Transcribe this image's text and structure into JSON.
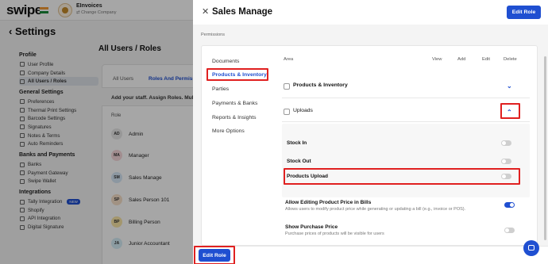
{
  "app": {
    "logo": "swipe",
    "company_name": "EInvoices",
    "change_company": "⇄ Change Company",
    "settings_title": "‹ Settings"
  },
  "sidebar": {
    "groups": [
      {
        "title": "Profile",
        "items": [
          "User Profile",
          "Company Details",
          "All Users / Roles"
        ]
      },
      {
        "title": "General Settings",
        "items": [
          "Preferences",
          "Thermal Print Settings",
          "Barcode Settings",
          "Signatures",
          "Notes & Terms",
          "Auto Reminders"
        ]
      },
      {
        "title": "Banks and Payments",
        "items": [
          "Banks",
          "Payment Gateway",
          "Swipe Wallet"
        ]
      },
      {
        "title": "Integrations",
        "items": [
          "Tally Integration",
          "Shopify",
          "API Integration",
          "Digital Signature"
        ]
      }
    ],
    "new_badge": "NEW"
  },
  "panel": {
    "title": "All Users / Roles",
    "tabs": [
      "All Users",
      "Roles And Permiss"
    ],
    "staff_note": "Add your staff. Assign Roles. Mult",
    "role_header": "Role",
    "roles": [
      {
        "initials": "AD",
        "name": "Admin",
        "color": "#e9e9e9"
      },
      {
        "initials": "MA",
        "name": "Manager",
        "color": "#f7d9dc"
      },
      {
        "initials": "SM",
        "name": "Sales Manage",
        "color": "#d7e8f7"
      },
      {
        "initials": "SP",
        "name": "Sales Person 101",
        "color": "#f7e0c9"
      },
      {
        "initials": "BP",
        "name": "Billing Person",
        "color": "#fbe7a8"
      },
      {
        "initials": "JA",
        "name": "Junior Accountant",
        "color": "#d6eef7"
      }
    ]
  },
  "drawer": {
    "close": "✕",
    "title": "Sales Manage",
    "edit_role_top": "Edit Role",
    "permissions_label": "Permissions",
    "categories": [
      "Documents",
      "Products & Inventory",
      "Parties",
      "Payments & Banks",
      "Reports & Insights",
      "More Options"
    ],
    "selected_category": "Products & Inventory",
    "columns": {
      "area": "Area",
      "view": "View",
      "add": "Add",
      "edit": "Edit",
      "delete": "Delete"
    },
    "sections": {
      "products_inventory": "Products & Inventory",
      "uploads": "Uploads"
    },
    "upload_items": [
      {
        "label": "Stock In",
        "enabled": false
      },
      {
        "label": "Stock Out",
        "enabled": false
      },
      {
        "label": "Products Upload",
        "enabled": false
      }
    ],
    "options": [
      {
        "title": "Allow Editing Product Price in Bills",
        "desc": "Allows users to modify product price while generating or updating a bill (e.g., invoice or POS).",
        "enabled": true
      },
      {
        "title": "Show Purchase Price",
        "desc": "Purchase prices of products will be visible for users",
        "enabled": false
      }
    ],
    "edit_role_bottom": "Edit Role"
  },
  "colors": {
    "primary": "#1f4fd1",
    "highlight": "#e02020"
  }
}
